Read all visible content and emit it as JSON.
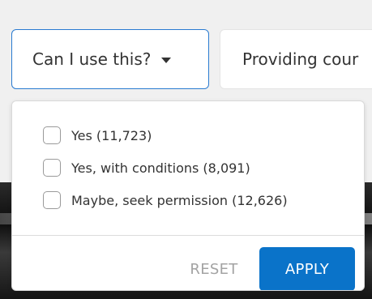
{
  "filters": {
    "active_label": "Can I use this?",
    "next_label": "Providing cour"
  },
  "dropdown": {
    "options": [
      {
        "label": "Yes (11,723)",
        "checked": false
      },
      {
        "label": "Yes, with conditions (8,091)",
        "checked": false
      },
      {
        "label": "Maybe, seek permission (12,626)",
        "checked": false
      }
    ],
    "reset_label": "RESET",
    "apply_label": "APPLY"
  },
  "colors": {
    "accent": "#0a73c9",
    "active_border": "#2a7bd1",
    "reset_text": "#a3a3a3"
  },
  "icons": {
    "caret": "caret-down-icon",
    "checkbox": "checkbox-unchecked"
  }
}
